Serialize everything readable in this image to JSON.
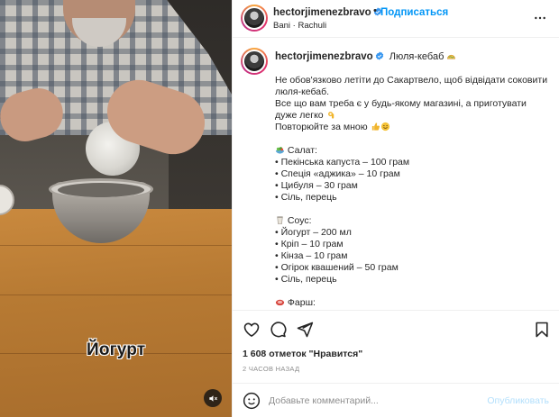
{
  "video": {
    "caption_overlay": "Йогурт",
    "mute_icon": "speaker-muted-icon"
  },
  "header": {
    "username": "hectorjimenezbravo",
    "separator": "•",
    "follow_label": "Подписаться",
    "location": "Bani · Rachuli",
    "more_icon": "more-horizontal-icon"
  },
  "caption": {
    "username": "hectorjimenezbravo",
    "title": "Люля-кебаб",
    "intro": [
      "Не обов'язково летіти до Сакартвело, щоб відвідати соковити",
      "люля-кебаб.",
      "Все що вам треба є у будь-якому магазині, а приготувати",
      "дуже легко",
      "Повторюйте за мною"
    ],
    "salad_heading": "Салат:",
    "salad_items": [
      "• Пекінська капуста – 100 грам",
      "• Спеція «аджика» – 10 грам",
      "• Цибуля – 30 грам",
      "• Сіль, перець"
    ],
    "sauce_heading": "Соус:",
    "sauce_items": [
      "• Йогурт – 200 мл",
      "• Кріп – 10 грам",
      "• Кінза – 10 грам",
      "• Огірок квашений – 50 грам",
      "• Сіль, перець"
    ],
    "mince_heading": "Фарш:"
  },
  "actions": {
    "like_icon": "heart-icon",
    "comment_icon": "comment-icon",
    "share_icon": "share-icon",
    "save_icon": "bookmark-icon"
  },
  "stats": {
    "likes": "1 608 отметок \"Нравится\"",
    "time": "2 ЧАСОВ НАЗАД"
  },
  "comment": {
    "placeholder": "Добавьте комментарий...",
    "post_label": "Опубликовать",
    "emoji_icon": "smiley-icon"
  },
  "colors": {
    "accent": "#0095f6",
    "post_disabled": "#b2dffc",
    "muted_text": "#8e8e8e"
  }
}
